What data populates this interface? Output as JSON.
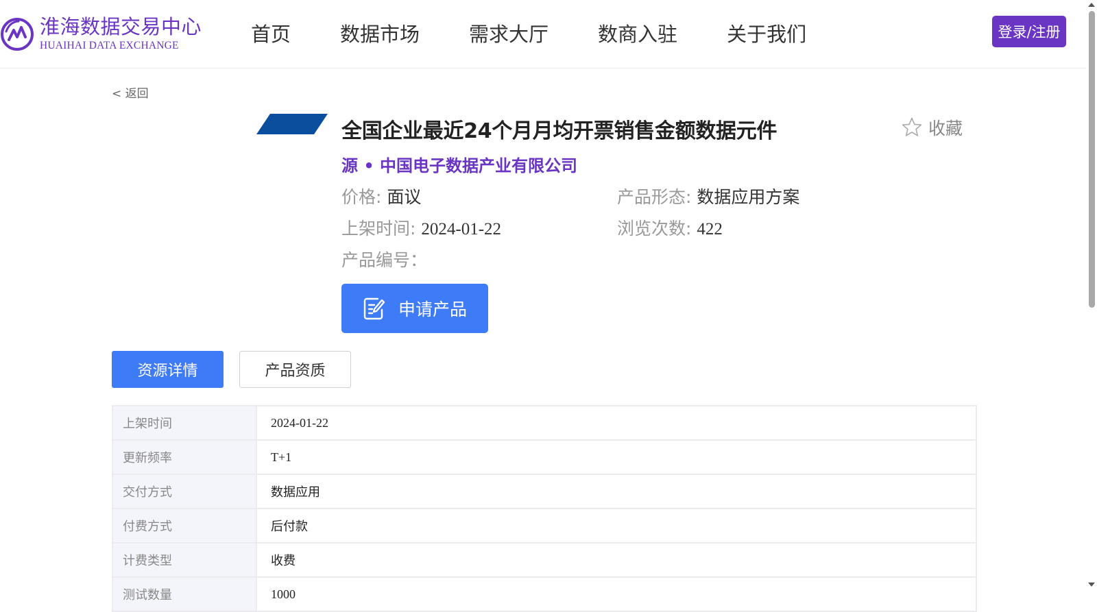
{
  "header": {
    "logo_cn": "淮海数据交易中心",
    "logo_en": "HUAIHAI DATA EXCHANGE",
    "logo_icon": "huaihai-logo-mark",
    "nav": [
      "首页",
      "数据市场",
      "需求大厅",
      "数商入驻",
      "关于我们"
    ],
    "login_label": "登录/注册"
  },
  "back_label": "< 返回",
  "product": {
    "title": "全国企业最近24个月月均开票销售金额数据元件",
    "favorite_label": "收藏",
    "favorite_icon": "star-outline-icon",
    "source": "源 • 中国电子数据产业有限公司",
    "price_label": "价格: ",
    "price_value": "面议",
    "form_label": "产品形态: ",
    "form_value": "数据应用方案",
    "listed_label": "上架时间: ",
    "listed_value": "2024-01-22",
    "views_label": "浏览次数: ",
    "views_value": "422",
    "code_label": "产品编号：",
    "apply_label": "申请产品",
    "apply_icon": "edit-document-icon"
  },
  "tabs": [
    {
      "label": "资源详情",
      "active": true
    },
    {
      "label": "产品资质",
      "active": false
    }
  ],
  "details": [
    {
      "key": "上架时间",
      "value": "2024-01-22"
    },
    {
      "key": "更新频率",
      "value": "T+1"
    },
    {
      "key": "交付方式",
      "value": "数据应用"
    },
    {
      "key": "付费方式",
      "value": "后付款"
    },
    {
      "key": "计费类型",
      "value": "收费"
    },
    {
      "key": "测试数量",
      "value": "1000"
    }
  ],
  "colors": {
    "brand_purple": "#6a35c2",
    "primary_blue": "#3e7bf7",
    "thumb_blue": "#0a4f9e"
  }
}
